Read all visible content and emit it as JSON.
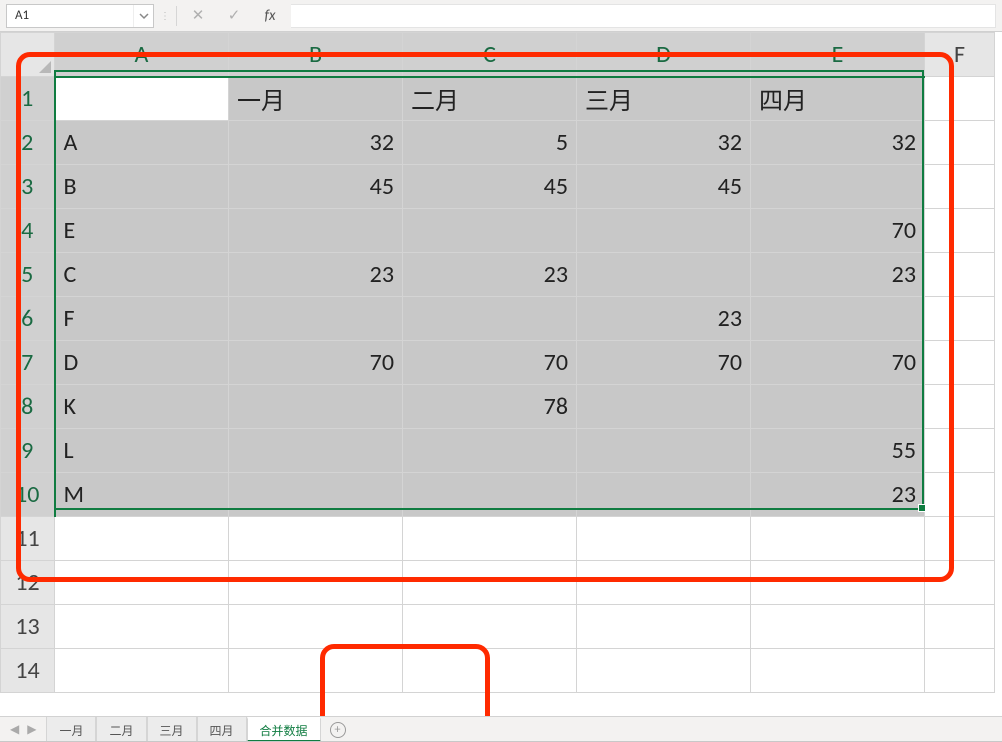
{
  "name_box": {
    "cell_ref": "A1"
  },
  "formula_bar": {
    "cancel_icon": "✕",
    "confirm_icon": "✓",
    "fx_label": "fx",
    "value": ""
  },
  "column_headers": [
    "A",
    "B",
    "C",
    "D",
    "E",
    "F"
  ],
  "row_headers": [
    "1",
    "2",
    "3",
    "4",
    "5",
    "6",
    "7",
    "8",
    "9",
    "10",
    "11",
    "12",
    "13",
    "14"
  ],
  "table": {
    "header_row": [
      "",
      "一月",
      "二月",
      "三月",
      "四月"
    ],
    "rows": [
      {
        "label": "A",
        "c": [
          "32",
          "5",
          "32",
          "32"
        ]
      },
      {
        "label": "B",
        "c": [
          "45",
          "45",
          "45",
          ""
        ]
      },
      {
        "label": "E",
        "c": [
          "",
          "",
          "",
          "70"
        ]
      },
      {
        "label": "C",
        "c": [
          "23",
          "23",
          "",
          "23"
        ]
      },
      {
        "label": "F",
        "c": [
          "",
          "",
          "23",
          ""
        ]
      },
      {
        "label": "D",
        "c": [
          "70",
          "70",
          "70",
          "70"
        ]
      },
      {
        "label": "K",
        "c": [
          "",
          "78",
          "",
          ""
        ]
      },
      {
        "label": "L",
        "c": [
          "",
          "",
          "",
          "55"
        ]
      },
      {
        "label": "M",
        "c": [
          "",
          "",
          "",
          "23"
        ]
      }
    ]
  },
  "sheet_tabs": {
    "items": [
      {
        "label": "一月",
        "active": false
      },
      {
        "label": "二月",
        "active": false
      },
      {
        "label": "三月",
        "active": false
      },
      {
        "label": "四月",
        "active": false
      },
      {
        "label": "合并数据",
        "active": true
      }
    ],
    "add_label": "+"
  },
  "selection": {
    "ref": "A1:E10"
  }
}
